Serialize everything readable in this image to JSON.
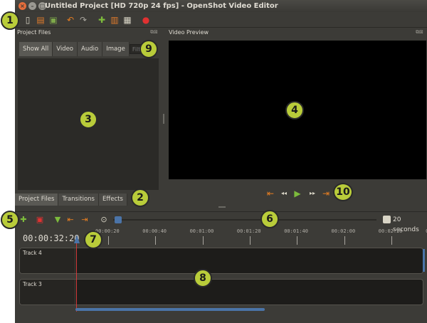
{
  "window": {
    "title": "Untitled Project [HD 720p 24 fps] - OpenShot Video Editor",
    "close_glyph": "×",
    "min_glyph": "–",
    "max_glyph": "□"
  },
  "toolbar": {
    "items": [
      {
        "name": "new-project-icon",
        "glyph": "▯",
        "color": "#d8d4c5"
      },
      {
        "name": "open-project-icon",
        "glyph": "▤",
        "color": "#e07b2b"
      },
      {
        "name": "save-project-icon",
        "glyph": "▣",
        "color": "#7ea84a"
      },
      {
        "name": "undo-icon",
        "glyph": "↶",
        "color": "#e67e22"
      },
      {
        "name": "redo-icon",
        "glyph": "↷",
        "color": "#a9a69f"
      },
      {
        "name": "import-files-icon",
        "glyph": "✚",
        "color": "#7dbb3c"
      },
      {
        "name": "profile-icon",
        "glyph": "▥",
        "color": "#e07b2b"
      },
      {
        "name": "fullscreen-icon",
        "glyph": "▦",
        "color": "#d8d4c5"
      },
      {
        "name": "export-video-icon",
        "glyph": "●",
        "color": "#e03131"
      }
    ]
  },
  "project_files": {
    "header": "Project Files",
    "filter_tabs": [
      "Show All",
      "Video",
      "Audio",
      "Image"
    ],
    "filter_placeholder": "Filter"
  },
  "video_preview": {
    "header": "Video Preview",
    "transport": [
      {
        "name": "jump-start-icon",
        "glyph": "⇤",
        "color": "#e67e22"
      },
      {
        "name": "rewind-icon",
        "glyph": "◂◂",
        "color": "#d8d4c5"
      },
      {
        "name": "play-icon",
        "glyph": "▶",
        "color": "#7dbb3c"
      },
      {
        "name": "fast-forward-icon",
        "glyph": "▸▸",
        "color": "#d8d4c5"
      },
      {
        "name": "jump-end-icon",
        "glyph": "⇥",
        "color": "#e67e22"
      }
    ]
  },
  "bottom_tabs": [
    "Project Files",
    "Transitions",
    "Effects"
  ],
  "timeline_toolbar": {
    "items": [
      {
        "name": "add-track-icon",
        "glyph": "✚",
        "color": "#7dbb3c"
      },
      {
        "name": "razor-icon",
        "glyph": "▣",
        "color": "#e03131"
      },
      {
        "name": "add-marker-icon",
        "glyph": "▼",
        "color": "#7dbb3c"
      },
      {
        "name": "previous-marker-icon",
        "glyph": "⇤",
        "color": "#e67e22"
      },
      {
        "name": "next-marker-icon",
        "glyph": "⇥",
        "color": "#e67e22"
      },
      {
        "name": "snapping-icon",
        "glyph": "⊙",
        "color": "#d8d4c5"
      }
    ],
    "zoom_label": "20 seconds"
  },
  "timeline": {
    "timecode": "00:00:32:20",
    "ruler_labels": [
      "00:00:20",
      "00:00:40",
      "00:01:00",
      "00:01:20",
      "00:01:40",
      "00:02:00",
      "00:02:20",
      "00:02:40"
    ],
    "tracks": [
      {
        "name": "Track 4"
      },
      {
        "name": "Track 3"
      }
    ]
  },
  "callouts": [
    "1",
    "2",
    "3",
    "4",
    "5",
    "6",
    "7",
    "8",
    "9",
    "10"
  ]
}
